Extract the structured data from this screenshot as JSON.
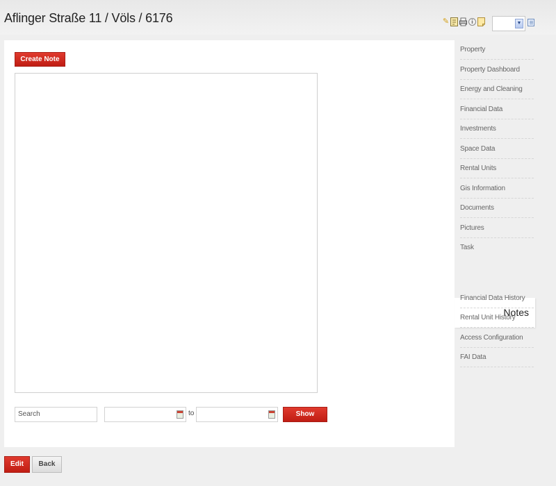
{
  "header": {
    "title": "Aflinger Straße 11 / Völs / 6176",
    "icons": [
      "pencil-icon",
      "edit-document-icon",
      "print-icon",
      "info-icon",
      "note-icon",
      "list-icon"
    ],
    "select_value": ""
  },
  "main": {
    "create_note_label": "Create Note",
    "notes_content": "",
    "search_placeholder": "Search",
    "date_from_value": "",
    "date_to_value": "",
    "to_label": "to",
    "show_label": "Show"
  },
  "sidebar": {
    "items": [
      {
        "label": "Property"
      },
      {
        "label": "Property Dashboard"
      },
      {
        "label": "Energy and Cleaning"
      },
      {
        "label": "Financial Data"
      },
      {
        "label": "Investments"
      },
      {
        "label": "Space Data"
      },
      {
        "label": "Rental Units"
      },
      {
        "label": "Gis Information"
      },
      {
        "label": "Documents"
      },
      {
        "label": "Pictures"
      },
      {
        "label": "Task"
      }
    ],
    "active": {
      "label": "Notes"
    },
    "items_after": [
      {
        "label": "Financial Data History"
      },
      {
        "label": "Rental Unit History"
      },
      {
        "label": "Access Configuration"
      },
      {
        "label": "FAI Data"
      }
    ]
  },
  "footer": {
    "edit_label": "Edit",
    "back_label": "Back"
  },
  "colors": {
    "accent_red": "#c9241b",
    "background": "#efefef",
    "panel": "#ffffff"
  }
}
